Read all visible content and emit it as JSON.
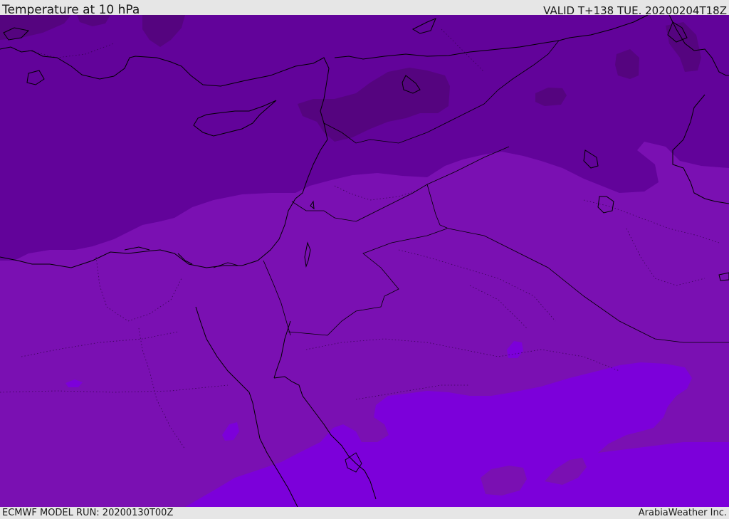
{
  "header": {
    "title": "Temperature at 10 hPa",
    "valid": "VALID T+138 TUE. 20200204T18Z"
  },
  "footer": {
    "model_run": "ECMWF MODEL RUN: 20200130T00Z",
    "credit": "ArabiaWeather Inc."
  },
  "map": {
    "field": "temperature",
    "level": "10 hPa",
    "colors": {
      "darkest_band": "#55047f",
      "dark_band": "#62039a",
      "mid_band": "#7a10b2",
      "light_band": "#7c00da",
      "coastline": "#000000",
      "border": "#000000"
    }
  }
}
